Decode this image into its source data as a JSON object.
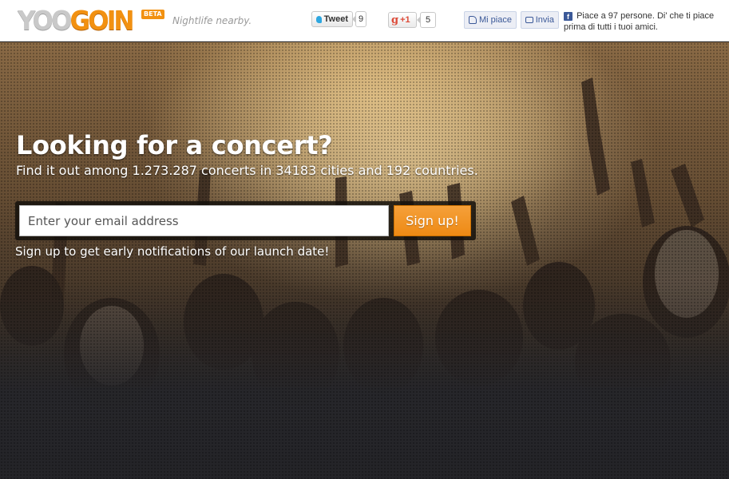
{
  "header": {
    "logo_part1": "YOO",
    "logo_part2": "GOIN",
    "beta_badge": "BETA",
    "tagline": "Nightlife nearby.",
    "tweet_label": "Tweet",
    "tweet_count": "9",
    "gplus_label": "+1",
    "gplus_count": "5",
    "fb_like_label": "Mi piace",
    "fb_send_label": "Invia",
    "fb_social_text": "Piace a 97 persone. Di' che ti piace prima di tutti i tuoi amici."
  },
  "hero": {
    "headline": "Looking for a concert?",
    "subline": "Find it out among 1.273.287 concerts in 34183 cities and 192 countries.",
    "email_placeholder": "Enter your email address",
    "signup_button": "Sign up!",
    "signup_note": "Sign up to get early notifications of our launch date!"
  },
  "colors": {
    "brand_orange": "#f29111",
    "logo_grey": "#c9c9c9",
    "facebook_blue": "#3b5998",
    "twitter_blue": "#2ea7e0",
    "gplus_red": "#dd4b39"
  },
  "icons": {
    "twitter": "twitter-bird-icon",
    "gplus": "google-g-icon",
    "fb_like": "thumbs-up-icon",
    "fb_send": "speech-bubble-icon",
    "fb_logo": "facebook-f-icon"
  }
}
